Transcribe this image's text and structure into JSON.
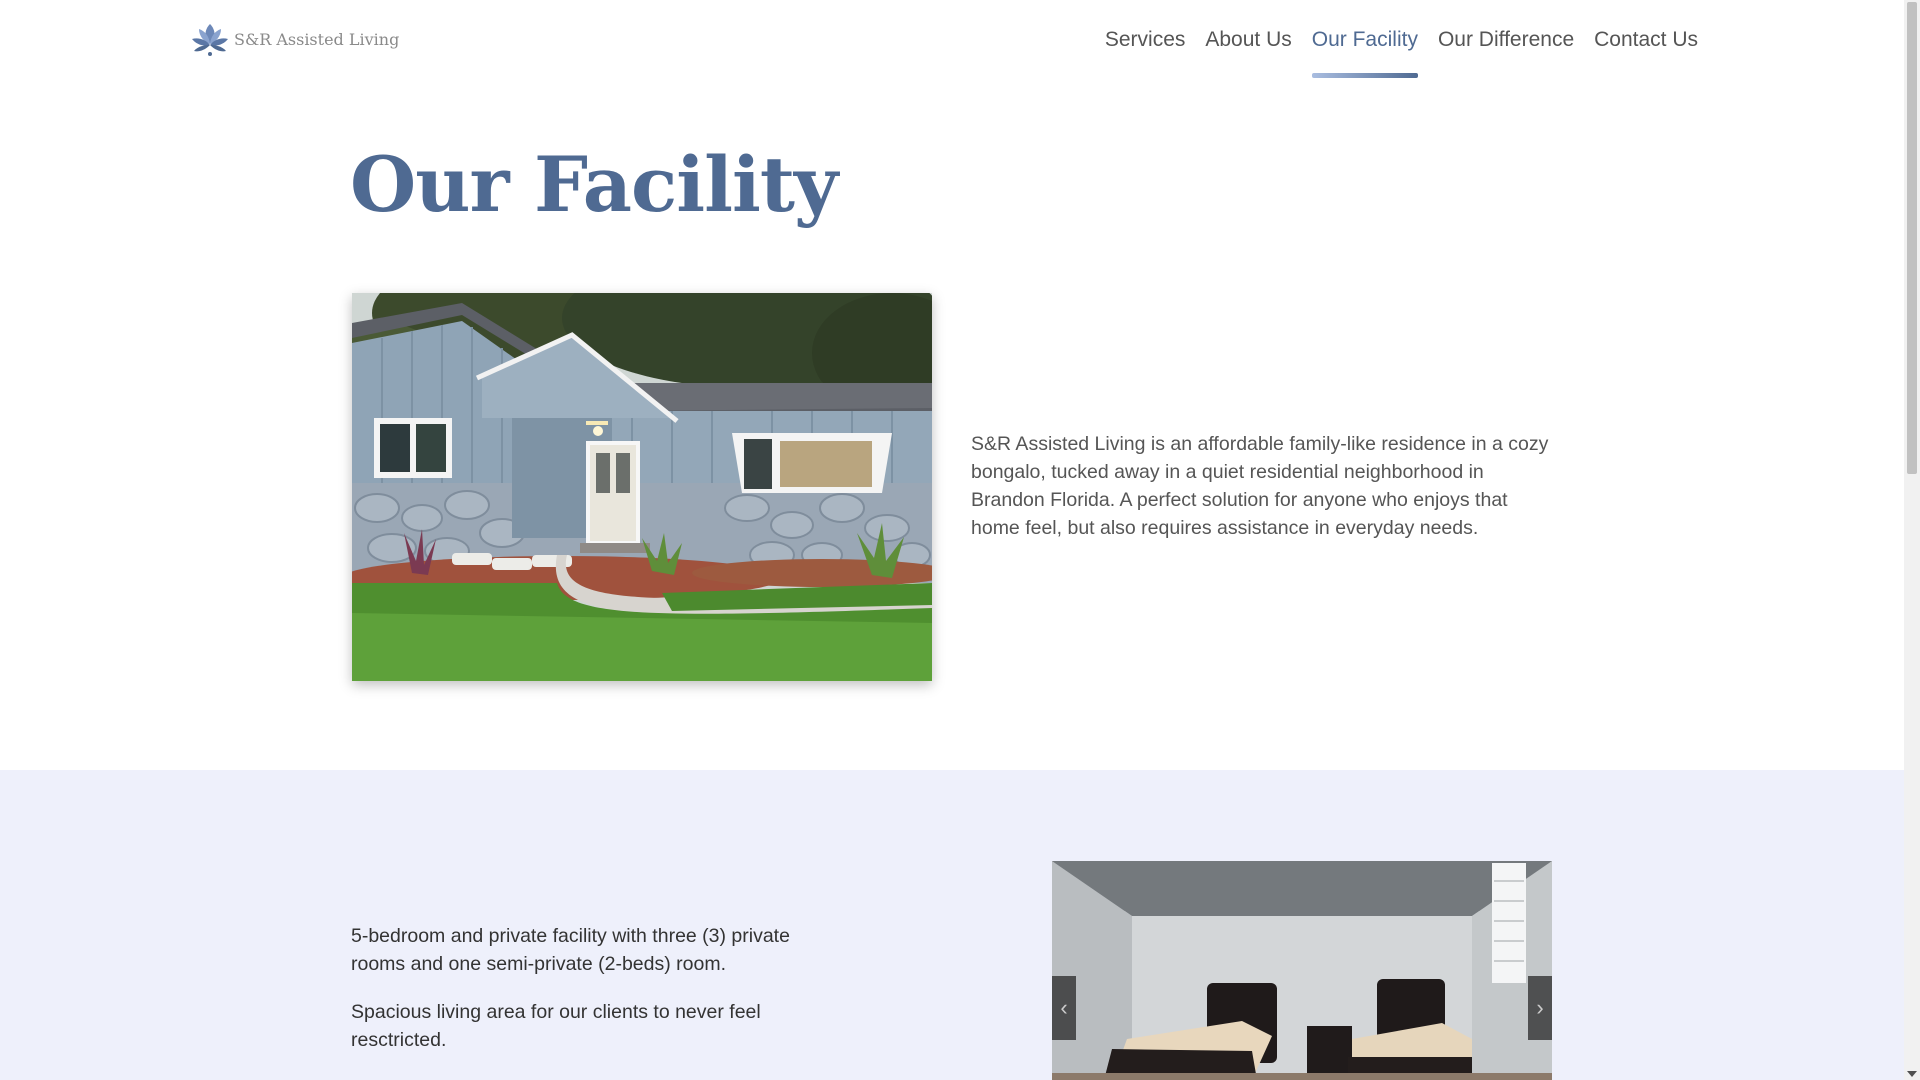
{
  "header": {
    "logo_text": "S&R Assisted Living",
    "nav": [
      {
        "label": "Services",
        "active": false
      },
      {
        "label": "About Us",
        "active": false
      },
      {
        "label": "Our Facility",
        "active": true
      },
      {
        "label": "Our Difference",
        "active": false
      },
      {
        "label": "Contact Us",
        "active": false
      }
    ]
  },
  "page": {
    "title": "Our Facility"
  },
  "intro": {
    "text": "S&R Assisted Living is an affordable family-like residence in a cozy bongalo, tucked away in a quiet residential neighborhood in Brandon Florida. A perfect solution for anyone who enjoys that home feel, but also requires assistance in everyday needs."
  },
  "features": {
    "items": [
      "5-bedroom and private facility with three (3) private rooms and one semi-private (2-beds) room.",
      "Spacious living area for our clients to never feel resctricted."
    ],
    "carousel": {
      "prev_icon": "chevron-left-icon",
      "next_icon": "chevron-right-icon",
      "prev_glyph": "‹",
      "next_glyph": "›"
    }
  },
  "colors": {
    "brand": "#4f6a92",
    "section_bg": "#eef0fb",
    "text": "#555555"
  }
}
